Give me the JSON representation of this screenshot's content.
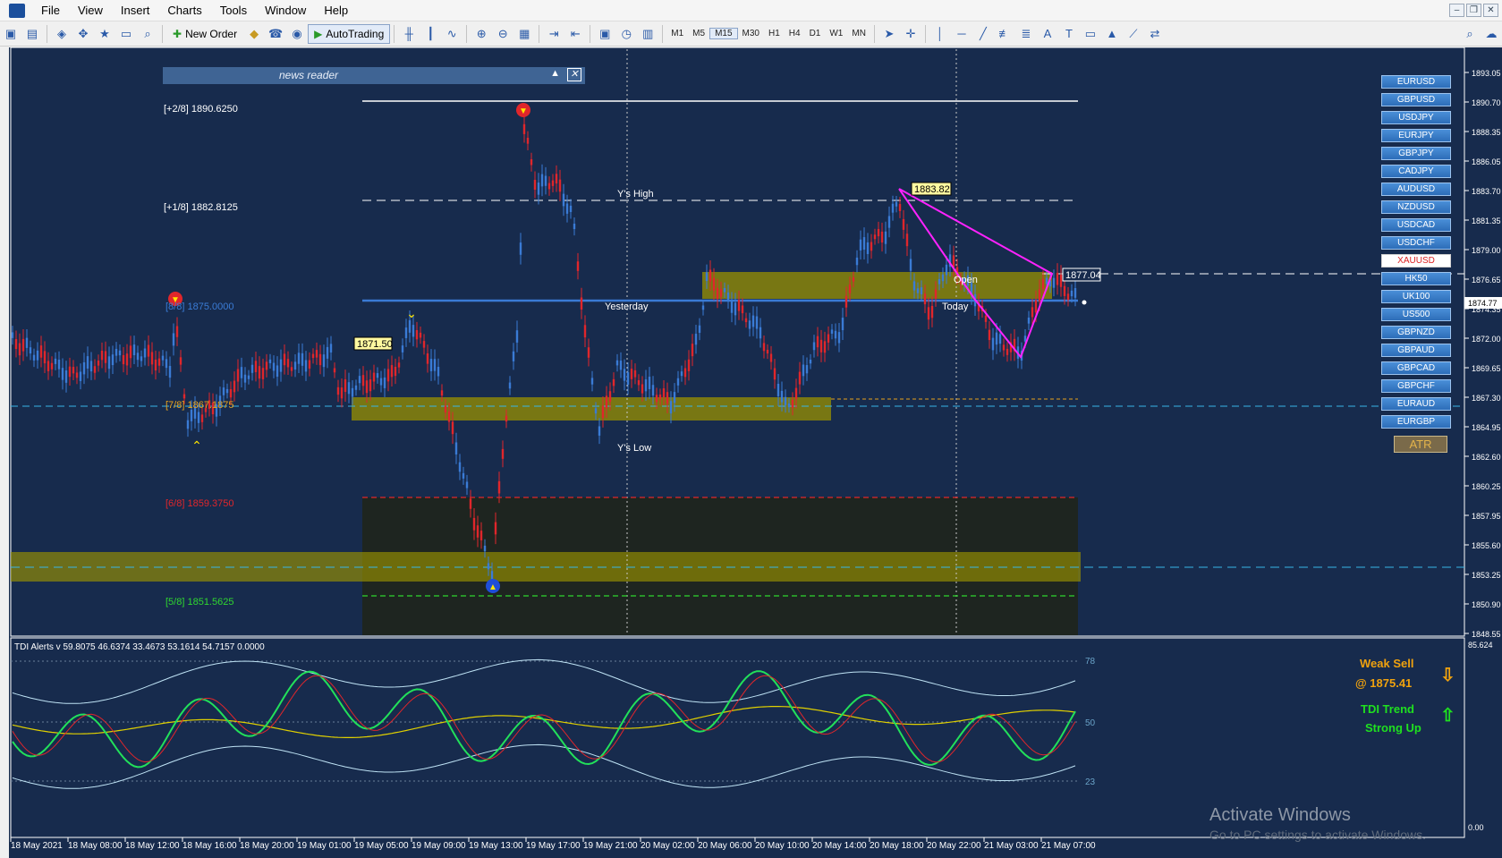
{
  "menu": [
    "File",
    "View",
    "Insert",
    "Charts",
    "Tools",
    "Window",
    "Help"
  ],
  "toolbar": {
    "new_order": "New Order",
    "autotrading": "AutoTrading",
    "timeframes": [
      "M1",
      "M5",
      "M15",
      "M30",
      "H1",
      "H4",
      "D1",
      "W1",
      "MN"
    ],
    "active_timeframe": "M15"
  },
  "news_reader": {
    "title": "news reader"
  },
  "murrey": [
    {
      "label": "[+2/8]  1890.6250",
      "color": "#ffffff"
    },
    {
      "label": "[+1/8]  1882.8125",
      "color": "#ffffff"
    },
    {
      "label": "[8/8]  1875.0000",
      "color": "#3a7bd5"
    },
    {
      "label": "[7/8]  1867.1875",
      "color": "#e7a11b"
    },
    {
      "label": "[6/8]  1859.3750",
      "color": "#e0262b"
    },
    {
      "label": "[5/8]  1851.5625",
      "color": "#2fd72f"
    }
  ],
  "chart_labels": {
    "ys_high": "Y's High",
    "ys_low": "Y's Low",
    "yesterday": "Yesterday",
    "today": "Today",
    "open": "Open",
    "tag_1871": "1871.50",
    "tag_1883": "1883.82",
    "tag_1877": "1877.04",
    "current_price": "1874.77"
  },
  "price_axis": [
    "1893.05",
    "1890.70",
    "1888.35",
    "1886.05",
    "1883.70",
    "1881.35",
    "1879.00",
    "1876.65",
    "1874.35",
    "1872.00",
    "1869.65",
    "1867.30",
    "1864.95",
    "1862.60",
    "1860.25",
    "1857.95",
    "1855.60",
    "1853.25",
    "1850.90",
    "1848.55"
  ],
  "time_axis": [
    "18 May 2021",
    "18 May 08:00",
    "18 May 12:00",
    "18 May 16:00",
    "18 May 20:00",
    "19 May 01:00",
    "19 May 05:00",
    "19 May 09:00",
    "19 May 13:00",
    "19 May 17:00",
    "19 May 21:00",
    "20 May 02:00",
    "20 May 06:00",
    "20 May 10:00",
    "20 May 14:00",
    "20 May 18:00",
    "20 May 22:00",
    "21 May 03:00",
    "21 May 07:00"
  ],
  "pairs": [
    "EURUSD",
    "GBPUSD",
    "USDJPY",
    "EURJPY",
    "GBPJPY",
    "CADJPY",
    "AUDUSD",
    "NZDUSD",
    "USDCAD",
    "USDCHF",
    "XAUUSD",
    "HK50",
    "UK100",
    "US500",
    "GBPNZD",
    "GBPAUD",
    "GBPCAD",
    "GBPCHF",
    "EURAUD",
    "EURGBP"
  ],
  "selected_pair": "XAUUSD",
  "atr_label": "ATR",
  "indicator": {
    "title": "TDI Alerts v 59.8075 46.6374 33.4673 53.1614 54.7157 0.0000",
    "levels": [
      "78",
      "50",
      "23"
    ],
    "axis_top": "85.624",
    "axis_bottom": "0.00",
    "signal": "Weak Sell",
    "signal_price": "@ 1875.41",
    "trend_label": "TDI Trend",
    "trend_value": "Strong Up",
    "colors": {
      "signal": "#f0a20e",
      "trend": "#1fe01f"
    }
  },
  "watermark": {
    "line1": "Activate Windows",
    "line2": "Go to PC settings to activate Windows."
  }
}
